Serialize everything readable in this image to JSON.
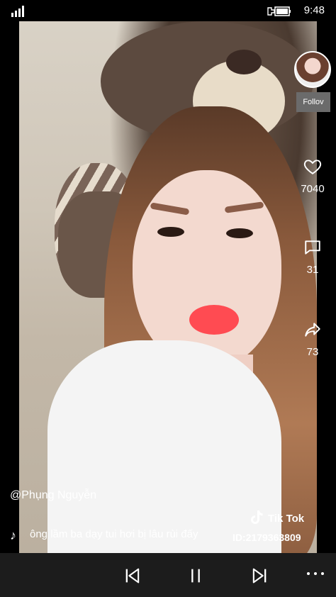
{
  "status": {
    "time": "9:48",
    "icons": [
      "signal-icon",
      "battery-icon"
    ]
  },
  "side_panel": {
    "avatar": "profile-avatar",
    "follow_label": "Follov",
    "likes_count": "7040",
    "comments_count": "31",
    "shares_count": "73"
  },
  "video_info": {
    "username": "@Phụng Nguyễn",
    "caption": "ông lầm ba dạy tui hơi bị lâu rùi đấy",
    "brand": "Tik Tok",
    "video_id": "ID:2179363809"
  },
  "controls": {
    "previous": "previous-icon",
    "pause": "pause-icon",
    "next": "next-icon",
    "more": "more-icon"
  }
}
